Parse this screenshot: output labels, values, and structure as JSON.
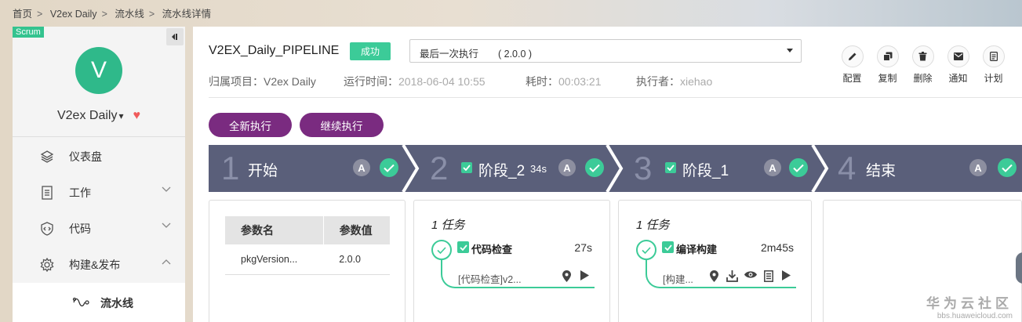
{
  "breadcrumb": [
    "首页",
    "V2ex Daily",
    "流水线",
    "流水线详情"
  ],
  "breadcrumb_sep": ">",
  "sidebar": {
    "scrum_tag": "Scrum",
    "avatar_letter": "V",
    "project_name": "V2ex Daily",
    "project_arrow": "▾",
    "heart": "♥",
    "menu": [
      {
        "label": "仪表盘",
        "icon": "layers-icon"
      },
      {
        "label": "工作",
        "icon": "list-icon",
        "expandable": true
      },
      {
        "label": "代码",
        "icon": "code-shield-icon",
        "expandable": true
      },
      {
        "label": "构建&发布",
        "icon": "gear-icon",
        "expanded": true
      }
    ],
    "submenu": {
      "label": "流水线",
      "icon": "pipeline-icon"
    }
  },
  "header": {
    "pipeline_name": "V2EX_Daily_PIPELINE",
    "status": "成功",
    "execution_select": "最后一次执行　　( 2.0.0 )",
    "project_label": "归属项目：",
    "project_value": "V2ex Daily",
    "run_time_label": "运行时间：",
    "run_time_value": "2018-06-04 10:55",
    "elapsed_label": "耗时：",
    "elapsed_value": "00:03:21",
    "executor_label": "执行者：",
    "executor_value": "xiehao"
  },
  "actions": [
    {
      "label": "配置",
      "icon": "pencil-icon"
    },
    {
      "label": "复制",
      "icon": "copy-icon"
    },
    {
      "label": "删除",
      "icon": "trash-icon"
    },
    {
      "label": "通知",
      "icon": "mail-icon"
    },
    {
      "label": "计划",
      "icon": "document-icon"
    }
  ],
  "buttons": {
    "new_run": "全新执行",
    "continue_run": "继续执行"
  },
  "stages": [
    {
      "num": "1",
      "title": "开始",
      "badge": "A"
    },
    {
      "num": "2",
      "title": "阶段_2",
      "duration": "34s",
      "badge": "A"
    },
    {
      "num": "3",
      "title": "阶段_1",
      "badge": "A"
    },
    {
      "num": "4",
      "title": "结束",
      "badge": "A"
    }
  ],
  "params": {
    "headers": [
      "参数名",
      "参数值"
    ],
    "rows": [
      [
        "pkgVersion...",
        "2.0.0"
      ]
    ]
  },
  "tasks": [
    {
      "count": "1 任务",
      "name": "代码检查",
      "duration": "27s",
      "desc": "[代码检查]v2...",
      "icons": [
        "location-icon",
        "play-icon"
      ]
    },
    {
      "count": "1 任务",
      "name": "编译构建",
      "duration": "2m45s",
      "desc": "[构建...",
      "icons": [
        "location-icon",
        "download-icon",
        "eye-icon",
        "document-icon",
        "play-icon"
      ]
    }
  ],
  "watermark": {
    "brand": "华为云社区",
    "url": "bbs.huaweicloud.com"
  },
  "colors": {
    "accent_green": "#3ccb98",
    "purple": "#7a2b80",
    "stage_bg": "#5a5f7a",
    "heart": "#f05a5a"
  }
}
